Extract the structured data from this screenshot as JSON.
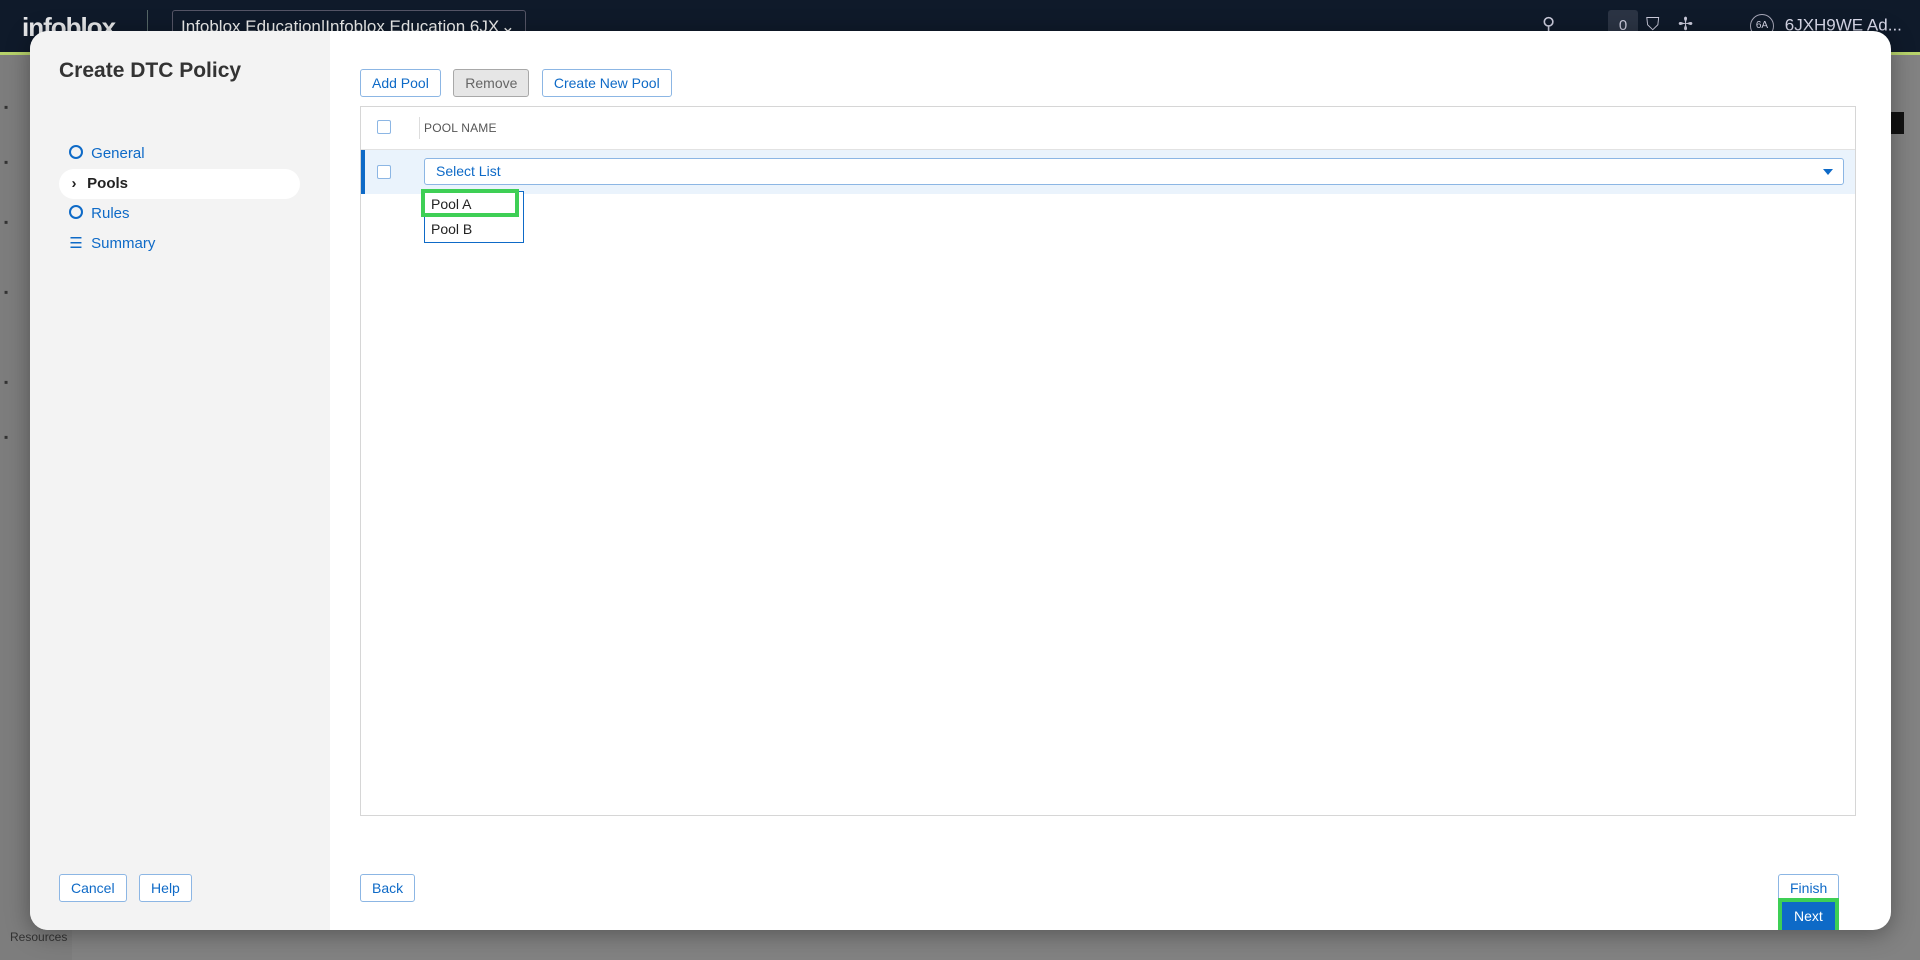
{
  "background": {
    "logo": "infoblox",
    "org_selector": "Infoblox Education|Infoblox Education 6JX",
    "notification_count": "0",
    "account": "6JXH9WE Ad...",
    "account_initials": "6A",
    "resources": "Resources"
  },
  "modal": {
    "title": "Create DTC Policy",
    "steps": [
      {
        "label": "General",
        "icon": "circle-icon"
      },
      {
        "label": "Pools",
        "icon": "chevron-right-icon"
      },
      {
        "label": "Rules",
        "icon": "circle-icon"
      },
      {
        "label": "Summary",
        "icon": "list-icon"
      }
    ],
    "active_step": "Pools",
    "toolbar": {
      "add_pool": "Add Pool",
      "remove": "Remove",
      "create_new_pool": "Create New Pool"
    },
    "grid": {
      "column_header": "POOL NAME",
      "row_select_placeholder": "Select List",
      "dropdown_options": [
        "Pool A",
        "Pool B"
      ]
    },
    "footer": {
      "cancel": "Cancel",
      "help": "Help",
      "back": "Back",
      "finish": "Finish",
      "next": "Next"
    }
  },
  "colors": {
    "accent": "#0e6ac7",
    "highlight": "#3ecf55",
    "sidebar_bg": "#f3f3f3"
  }
}
